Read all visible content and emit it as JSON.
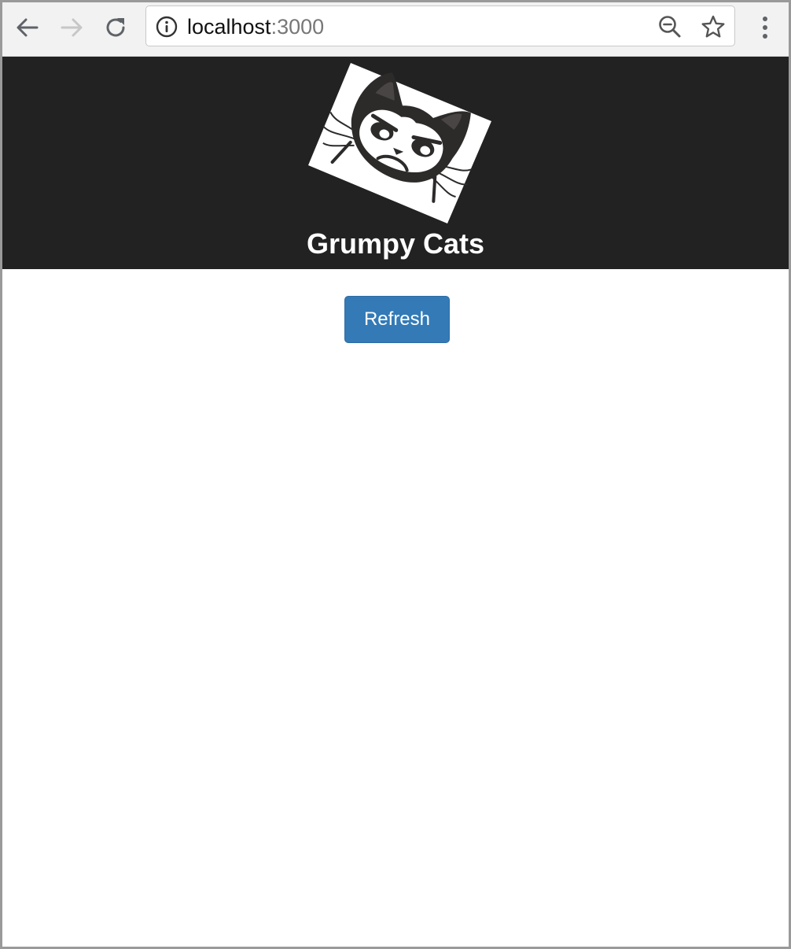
{
  "browser": {
    "url_host": "localhost",
    "url_port": ":3000",
    "icons": {
      "back": "back-arrow-icon",
      "forward": "forward-arrow-icon",
      "reload": "reload-icon",
      "info": "info-icon",
      "zoom": "zoom-out-icon",
      "bookmark": "star-icon",
      "menu": "kebab-menu-icon"
    }
  },
  "header": {
    "title": "Grumpy Cats",
    "background_color": "#222222",
    "logo": "grumpy-cat-logo"
  },
  "main": {
    "refresh_label": "Refresh",
    "button_color": "#337ab7"
  }
}
